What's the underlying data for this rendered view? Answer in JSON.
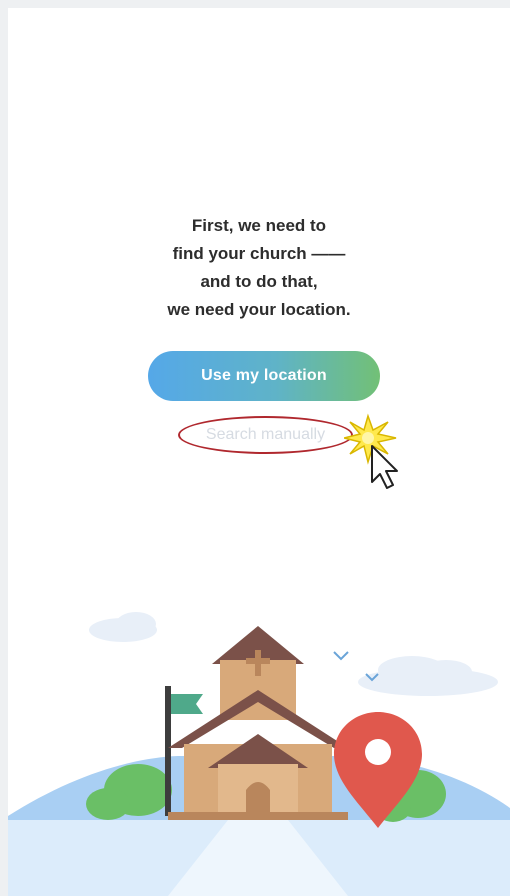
{
  "onboarding": {
    "intro_lines": [
      "First, we need to",
      "find your church ——",
      "and to do that,",
      "we need your location."
    ],
    "use_location_label": "Use my location",
    "search_manually_label": "Search manually"
  },
  "colors": {
    "button_start": "#55a8e8",
    "button_end": "#72c076",
    "highlight_ring": "#b0282e",
    "pin": "#e0584d"
  },
  "icons": [
    "church-illustration",
    "location-pin-icon",
    "flag-icon",
    "cursor-icon",
    "cloud-icon",
    "bird-icon"
  ]
}
